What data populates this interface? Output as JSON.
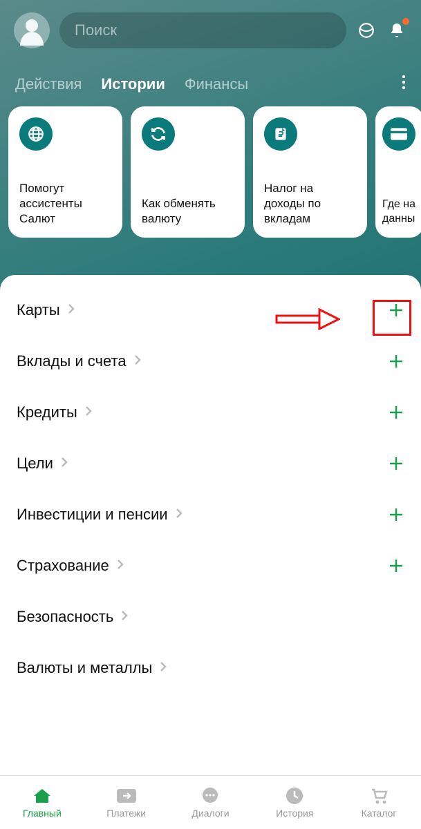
{
  "header": {
    "search_placeholder": "Поиск"
  },
  "tabs": {
    "items": [
      "Действия",
      "Истории",
      "Финансы"
    ],
    "active_index": 1
  },
  "stories": [
    {
      "text": "Помогут ассистенты Салют",
      "icon": "globe"
    },
    {
      "text": "Как обменять валюту",
      "icon": "refresh"
    },
    {
      "text": "Налог на доходы по вкладам",
      "icon": "doc-ruble"
    },
    {
      "text": "Где на данны",
      "icon": "card"
    }
  ],
  "sections": [
    {
      "title": "Карты",
      "has_plus": true,
      "highlighted": true
    },
    {
      "title": "Вклады и счета",
      "has_plus": true
    },
    {
      "title": "Кредиты",
      "has_plus": true
    },
    {
      "title": "Цели",
      "has_plus": true
    },
    {
      "title": "Инвестиции и пенсии",
      "has_plus": true
    },
    {
      "title": "Страхование",
      "has_plus": true
    },
    {
      "title": "Безопасность",
      "has_plus": false
    },
    {
      "title": "Валюты и металлы",
      "has_plus": false
    }
  ],
  "bottom_nav": {
    "items": [
      {
        "label": "Главный",
        "icon": "home",
        "active": true
      },
      {
        "label": "Платежи",
        "icon": "arrow-right-box"
      },
      {
        "label": "Диалоги",
        "icon": "chat"
      },
      {
        "label": "История",
        "icon": "clock"
      },
      {
        "label": "Каталог",
        "icon": "cart"
      }
    ]
  },
  "colors": {
    "accent_green": "#1aa04a",
    "teal": "#0a7a7a",
    "annotation_red": "#e11",
    "notification_orange": "#ff6a2b"
  }
}
